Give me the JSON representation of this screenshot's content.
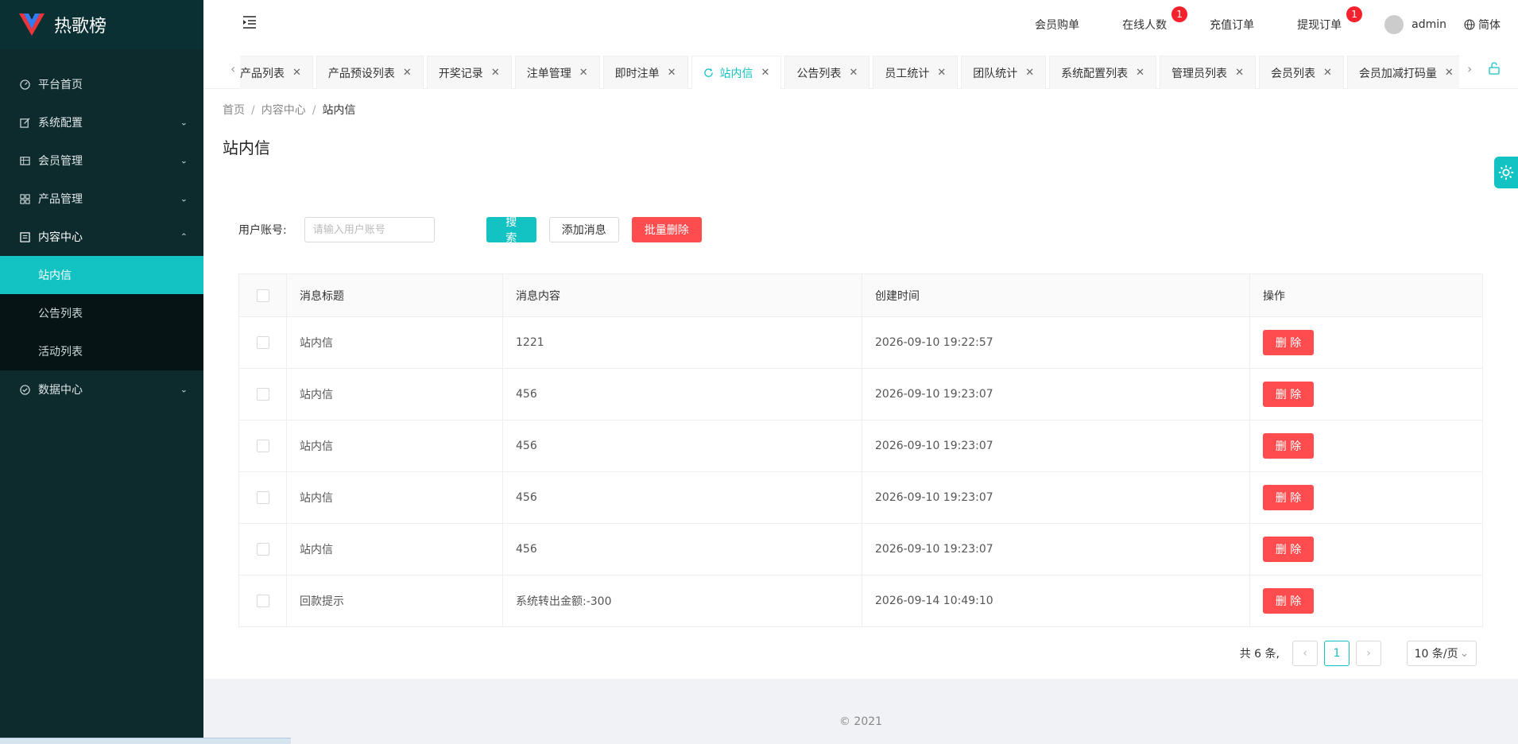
{
  "app": {
    "name": "热歌榜"
  },
  "sidebar": {
    "items": [
      {
        "label": "平台首页",
        "icon": "dashboard-icon"
      },
      {
        "label": "系统配置",
        "icon": "edit-icon"
      },
      {
        "label": "会员管理",
        "icon": "table-icon"
      },
      {
        "label": "产品管理",
        "icon": "grid-icon"
      },
      {
        "label": "内容中心",
        "icon": "document-icon"
      },
      {
        "label": "数据中心",
        "icon": "check-circle-icon"
      }
    ],
    "sub_items": [
      {
        "label": "站内信",
        "active": true
      },
      {
        "label": "公告列表"
      },
      {
        "label": "活动列表"
      }
    ]
  },
  "header": {
    "links": [
      {
        "label": "会员购单"
      },
      {
        "label": "在线人数",
        "badge": "1"
      },
      {
        "label": "充值订单"
      },
      {
        "label": "提现订单",
        "badge": "1"
      }
    ],
    "user": "admin",
    "language": "简体"
  },
  "tabs": [
    {
      "label": "产品列表"
    },
    {
      "label": "产品预设列表"
    },
    {
      "label": "开奖记录"
    },
    {
      "label": "注单管理"
    },
    {
      "label": "即时注单"
    },
    {
      "label": "站内信",
      "active": true
    },
    {
      "label": "公告列表"
    },
    {
      "label": "员工统计"
    },
    {
      "label": "团队统计"
    },
    {
      "label": "系统配置列表"
    },
    {
      "label": "管理员列表"
    },
    {
      "label": "会员列表"
    },
    {
      "label": "会员加减打码量"
    }
  ],
  "breadcrumb": {
    "home": "首页",
    "section": "内容中心",
    "current": "站内信"
  },
  "page_title": "站内信",
  "filter": {
    "label": "用户账号:",
    "placeholder": "请输入用户账号",
    "search_label": "搜 索",
    "add_label": "添加消息",
    "batch_delete_label": "批量删除"
  },
  "table": {
    "columns": [
      "消息标题",
      "消息内容",
      "创建时间",
      "操作"
    ],
    "delete_label": "删 除",
    "rows": [
      {
        "title": "站内信",
        "content": "1221",
        "created": "2026-09-10 19:22:57"
      },
      {
        "title": "站内信",
        "content": "456",
        "created": "2026-09-10 19:23:07"
      },
      {
        "title": "站内信",
        "content": "456",
        "created": "2026-09-10 19:23:07"
      },
      {
        "title": "站内信",
        "content": "456",
        "created": "2026-09-10 19:23:07"
      },
      {
        "title": "站内信",
        "content": "456",
        "created": "2026-09-10 19:23:07"
      },
      {
        "title": "回款提示",
        "content": "系统转出金额:-300",
        "created": "2026-09-14 10:49:10"
      }
    ]
  },
  "pagination": {
    "total": "共 6 条,",
    "current_page": "1",
    "page_size": "10 条/页"
  },
  "footer": {
    "copyright": "2021"
  },
  "colors": {
    "accent": "#13c2c2",
    "danger": "#ff4d4f",
    "sidebar": "#0d2a2d"
  }
}
